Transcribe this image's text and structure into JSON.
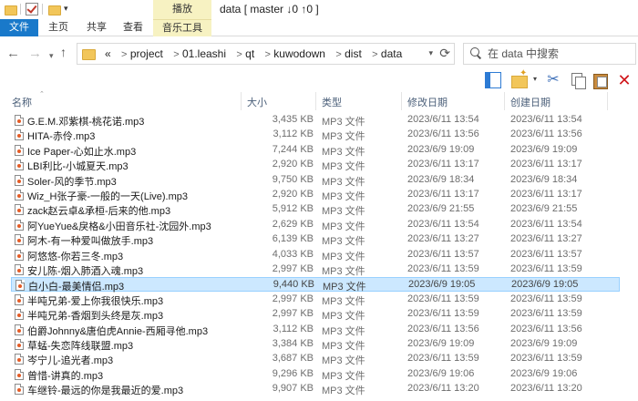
{
  "window": {
    "title": "data [ master ↓0 ↑0 ]",
    "ribbon_context_group": "播放"
  },
  "tabs": [
    {
      "label": "文件"
    },
    {
      "label": "主页"
    },
    {
      "label": "共享"
    },
    {
      "label": "查看"
    },
    {
      "label": "音乐工具"
    }
  ],
  "address": {
    "prefix": "«",
    "crumbs": [
      "project",
      "01.leashi",
      "qt",
      "kuwodown",
      "dist",
      "data"
    ]
  },
  "search": {
    "placeholder": "在 data 中搜索",
    "value": ""
  },
  "columns": {
    "name": "名称",
    "size": "大小",
    "type": "类型",
    "modified": "修改日期",
    "created": "创建日期"
  },
  "files": [
    {
      "name": "G.E.M.邓紫棋-桃花诺.mp3",
      "size": "3,435 KB",
      "type": "MP3 文件",
      "modified": "2023/6/11 13:54",
      "created": "2023/6/11 13:54"
    },
    {
      "name": "HITA-赤伶.mp3",
      "size": "3,112 KB",
      "type": "MP3 文件",
      "modified": "2023/6/11 13:56",
      "created": "2023/6/11 13:56"
    },
    {
      "name": "Ice Paper-心如止水.mp3",
      "size": "7,244 KB",
      "type": "MP3 文件",
      "modified": "2023/6/9 19:09",
      "created": "2023/6/9 19:09"
    },
    {
      "name": "LBI利比-小城夏天.mp3",
      "size": "2,920 KB",
      "type": "MP3 文件",
      "modified": "2023/6/11 13:17",
      "created": "2023/6/11 13:17"
    },
    {
      "name": "Soler-风的季节.mp3",
      "size": "9,750 KB",
      "type": "MP3 文件",
      "modified": "2023/6/9 18:34",
      "created": "2023/6/9 18:34"
    },
    {
      "name": "Wiz_H张子豪-一般的一天(Live).mp3",
      "size": "2,920 KB",
      "type": "MP3 文件",
      "modified": "2023/6/11 13:17",
      "created": "2023/6/11 13:17"
    },
    {
      "name": "zack赵云卓&承桓-后来的他.mp3",
      "size": "5,912 KB",
      "type": "MP3 文件",
      "modified": "2023/6/9 21:55",
      "created": "2023/6/9 21:55"
    },
    {
      "name": "阿YueYue&戾格&小田音乐社-沈园外.mp3",
      "size": "2,629 KB",
      "type": "MP3 文件",
      "modified": "2023/6/11 13:54",
      "created": "2023/6/11 13:54"
    },
    {
      "name": "阿木-有一种爱叫做放手.mp3",
      "size": "6,139 KB",
      "type": "MP3 文件",
      "modified": "2023/6/11 13:27",
      "created": "2023/6/11 13:27"
    },
    {
      "name": "阿悠悠-你若三冬.mp3",
      "size": "4,033 KB",
      "type": "MP3 文件",
      "modified": "2023/6/11 13:57",
      "created": "2023/6/11 13:57"
    },
    {
      "name": "安儿陈-烟入肺酒入魂.mp3",
      "size": "2,997 KB",
      "type": "MP3 文件",
      "modified": "2023/6/11 13:59",
      "created": "2023/6/11 13:59"
    },
    {
      "name": "白小白-最美情侣.mp3",
      "size": "9,440 KB",
      "type": "MP3 文件",
      "modified": "2023/6/9 19:05",
      "created": "2023/6/9 19:05",
      "selected": true
    },
    {
      "name": "半吨兄弟-爱上你我很快乐.mp3",
      "size": "2,997 KB",
      "type": "MP3 文件",
      "modified": "2023/6/11 13:59",
      "created": "2023/6/11 13:59"
    },
    {
      "name": "半吨兄弟-香烟到头终是灰.mp3",
      "size": "2,997 KB",
      "type": "MP3 文件",
      "modified": "2023/6/11 13:59",
      "created": "2023/6/11 13:59"
    },
    {
      "name": "伯爵Johnny&唐伯虎Annie-西厢寻他.mp3",
      "size": "3,112 KB",
      "type": "MP3 文件",
      "modified": "2023/6/11 13:56",
      "created": "2023/6/11 13:56"
    },
    {
      "name": "草蜢-失恋阵线联盟.mp3",
      "size": "3,384 KB",
      "type": "MP3 文件",
      "modified": "2023/6/9 19:09",
      "created": "2023/6/9 19:09"
    },
    {
      "name": "岑宁儿-追光者.mp3",
      "size": "3,687 KB",
      "type": "MP3 文件",
      "modified": "2023/6/11 13:59",
      "created": "2023/6/11 13:59"
    },
    {
      "name": "曾惜-讲真的.mp3",
      "size": "9,296 KB",
      "type": "MP3 文件",
      "modified": "2023/6/9 19:06",
      "created": "2023/6/9 19:06"
    },
    {
      "name": "车继铃-最远的你是我最近的爱.mp3",
      "size": "9,907 KB",
      "type": "MP3 文件",
      "modified": "2023/6/11 13:20",
      "created": "2023/6/11 13:20"
    }
  ]
}
